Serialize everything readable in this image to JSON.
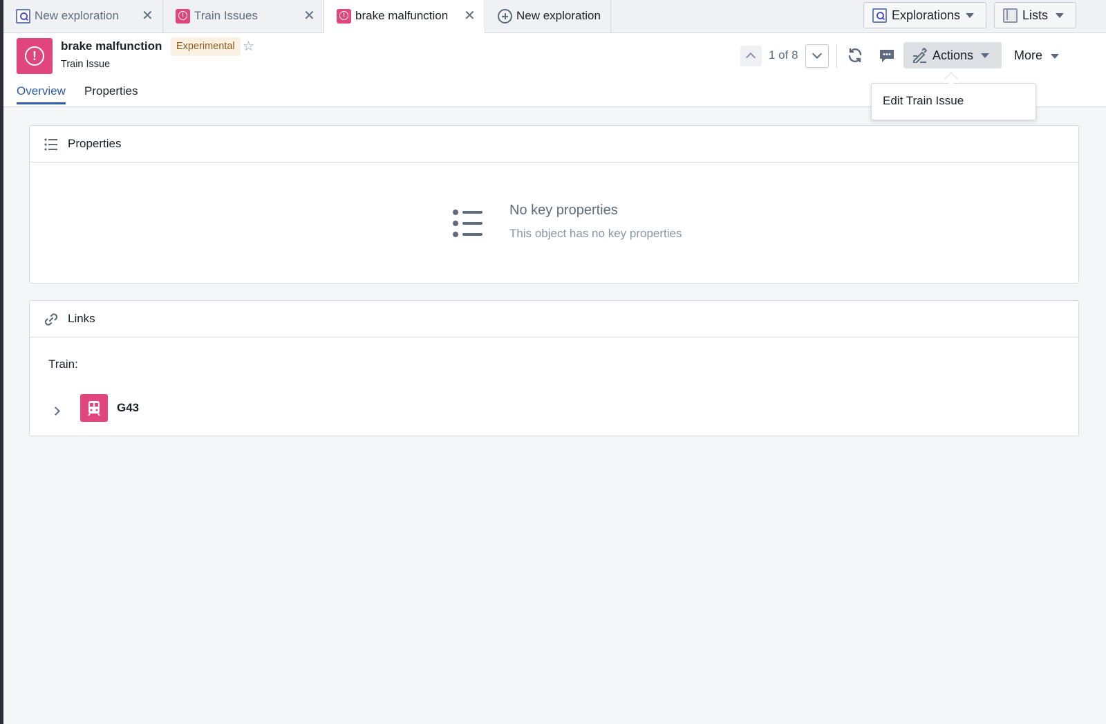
{
  "tabs": [
    {
      "label": "New exploration",
      "icon": "search-icon",
      "closable": true
    },
    {
      "label": "Train Issues",
      "icon": "issue-icon",
      "closable": true
    },
    {
      "label": "brake malfunction",
      "icon": "issue-icon",
      "closable": true,
      "active": true
    },
    {
      "label": "New exploration",
      "icon": "plus-circle-icon",
      "closable": false
    }
  ],
  "topbar": {
    "explorations_label": "Explorations",
    "lists_label": "Lists"
  },
  "object": {
    "title": "brake malfunction",
    "badge": "Experimental",
    "subtitle": "Train Issue",
    "icon_color": "#e0457b"
  },
  "nav": {
    "count": "1 of 8"
  },
  "toolbar": {
    "actions_label": "Actions",
    "more_label": "More"
  },
  "actions_menu": {
    "items": [
      "Edit Train Issue"
    ]
  },
  "page_tabs": [
    "Overview",
    "Properties"
  ],
  "properties_card": {
    "title": "Properties",
    "empty_title": "No key properties",
    "empty_desc": "This object has no key properties"
  },
  "links_card": {
    "title": "Links",
    "group_label": "Train:",
    "items": [
      {
        "name": "G43",
        "icon": "train-icon"
      }
    ]
  },
  "colors": {
    "accent": "#2d5ba6",
    "object_pink": "#e0457b",
    "badge_bg": "#fbf1e3"
  }
}
